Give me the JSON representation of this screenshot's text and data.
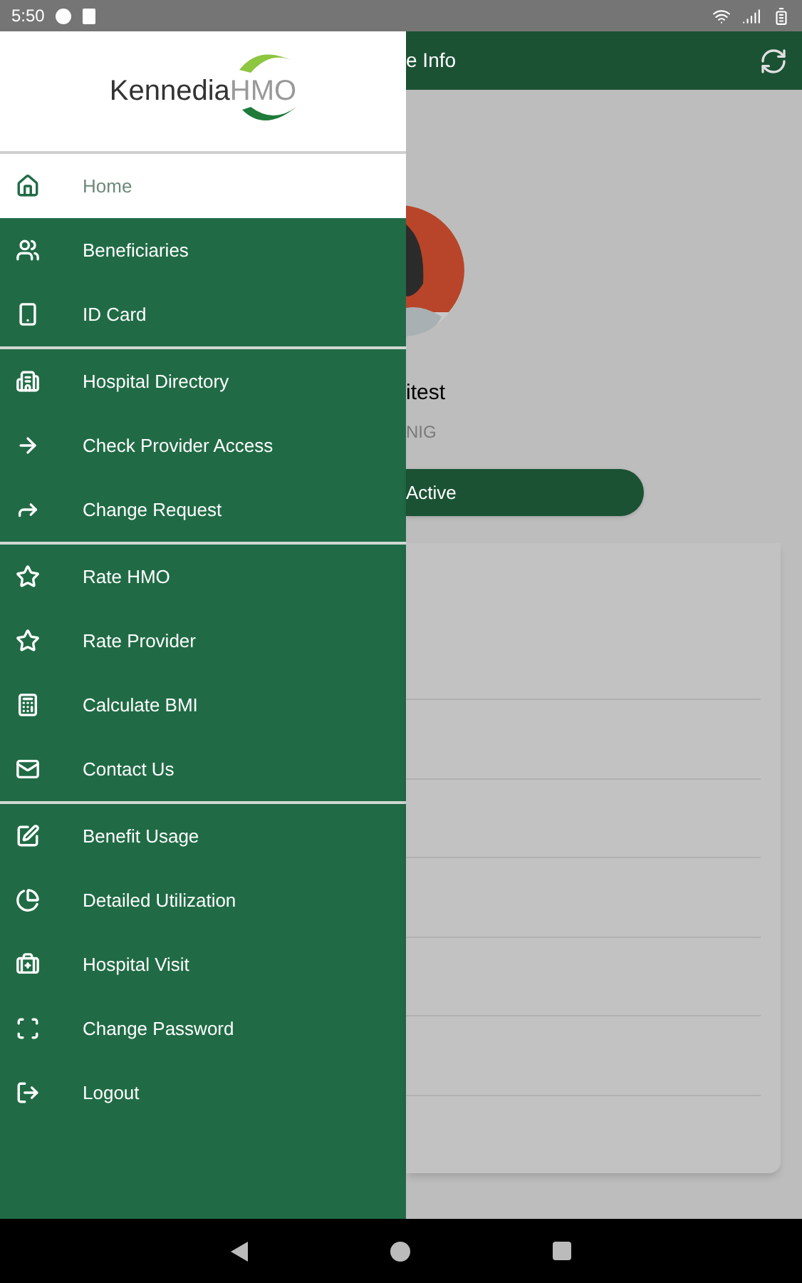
{
  "status_bar": {
    "time": "5:50"
  },
  "drawer": {
    "logo": {
      "name": "Kennedia",
      "suffix": "HMO"
    },
    "groups": [
      [
        {
          "label": "Home",
          "selected": true
        },
        {
          "label": "Beneficiaries",
          "selected": false
        },
        {
          "label": "ID Card",
          "selected": false
        }
      ],
      [
        {
          "label": "Hospital Directory",
          "selected": false
        },
        {
          "label": "Check Provider Access",
          "selected": false
        },
        {
          "label": "Change Request",
          "selected": false
        }
      ],
      [
        {
          "label": "Rate HMO",
          "selected": false
        },
        {
          "label": "Rate Provider",
          "selected": false
        },
        {
          "label": "Calculate BMI",
          "selected": false
        },
        {
          "label": "Contact Us",
          "selected": false
        }
      ],
      [
        {
          "label": "Benefit Usage",
          "selected": false
        },
        {
          "label": "Detailed Utilization",
          "selected": false
        },
        {
          "label": "Hospital Visit",
          "selected": false
        },
        {
          "label": "Change Password",
          "selected": false
        },
        {
          "label": "Logout",
          "selected": false
        }
      ]
    ]
  },
  "app_bar": {
    "title": "e Info"
  },
  "profile": {
    "name": "itest",
    "subtitle": "NIG",
    "status": "Active"
  }
}
